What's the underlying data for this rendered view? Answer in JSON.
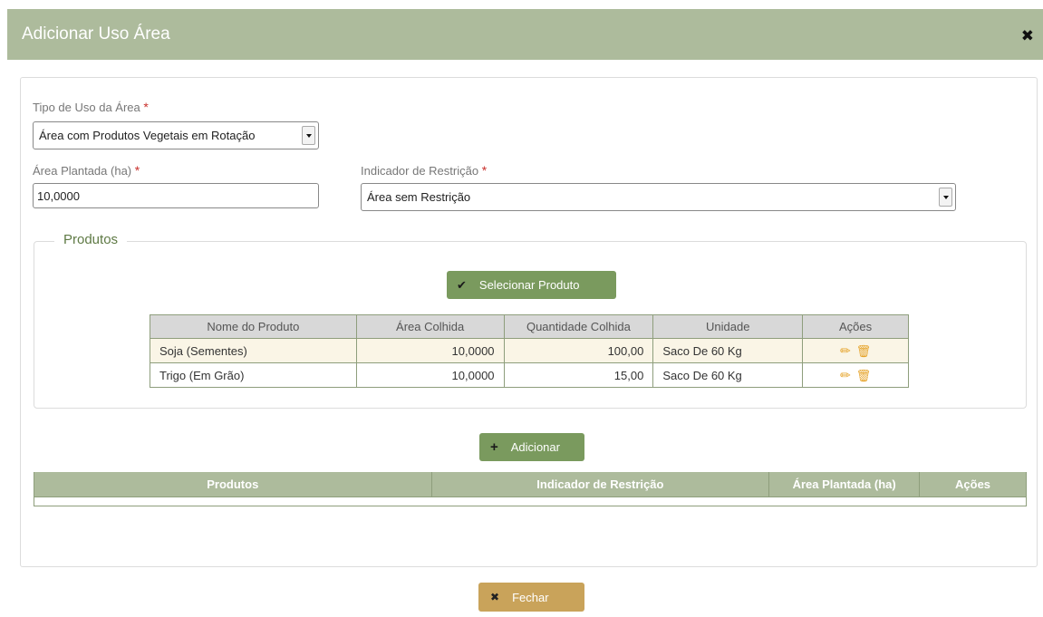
{
  "modal": {
    "title": "Adicionar Uso Área",
    "close_icon": "close-icon"
  },
  "form": {
    "tipo_label": "Tipo de Uso da Área",
    "tipo_value": "Área com Produtos Vegetais em Rotação",
    "area_label": "Área Plantada (ha)",
    "area_value": "10,0000",
    "indicador_label": "Indicador de Restrição",
    "indicador_value": "Área sem Restrição",
    "required_mark": "*"
  },
  "produtos": {
    "legend": "Produtos",
    "select_button": "Selecionar Produto",
    "columns": [
      "Nome do Produto",
      "Área Colhida",
      "Quantidade Colhida",
      "Unidade",
      "Ações"
    ],
    "rows": [
      {
        "nome": "Soja (Sementes)",
        "area": "10,0000",
        "quantidade": "100,00",
        "unidade": "Saco De 60 Kg"
      },
      {
        "nome": "Trigo (Em Grão)",
        "area": "10,0000",
        "quantidade": "15,00",
        "unidade": "Saco De 60 Kg"
      }
    ]
  },
  "uso": {
    "add_button": "Adicionar",
    "columns": [
      "Produtos",
      "Indicador de Restrição",
      "Área Plantada (ha)",
      "Ações"
    ]
  },
  "footer": {
    "close_button": "Fechar"
  },
  "colors": {
    "header": "#adbb9c",
    "button_green": "#7a9a5e",
    "button_tan": "#c9a35a",
    "legend": "#5f7a45"
  }
}
